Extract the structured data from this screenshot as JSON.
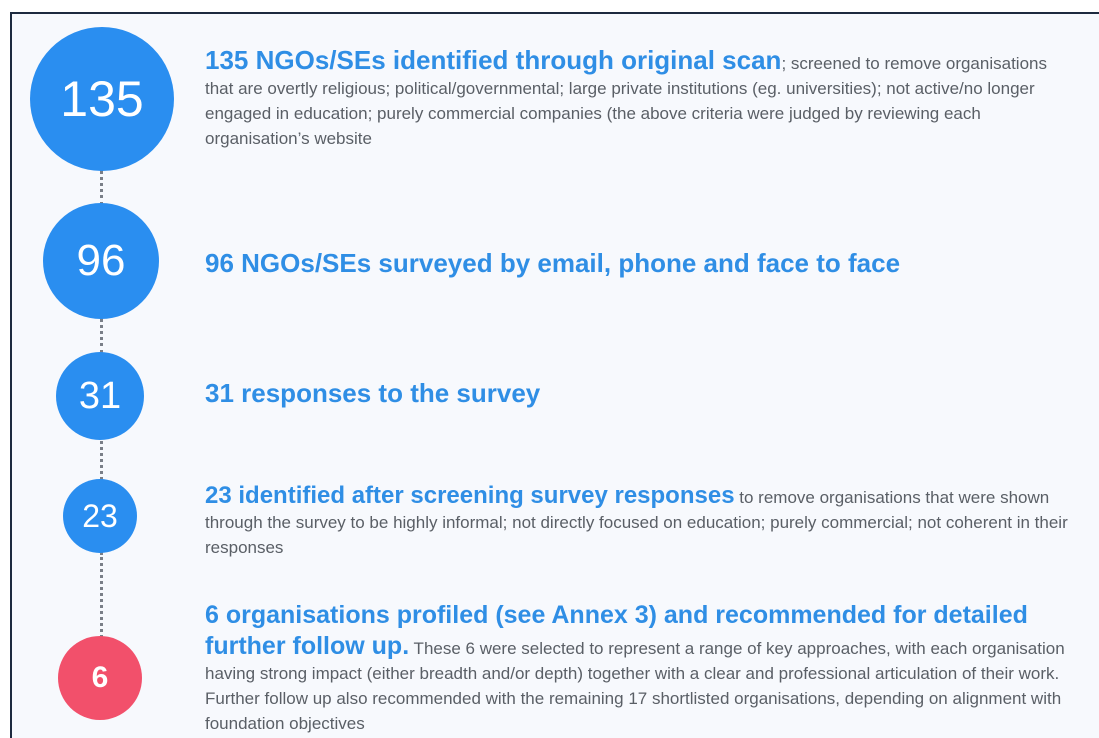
{
  "colors": {
    "step_circle": "#2a8ef0",
    "final_circle": "#f2506b",
    "headline": "#2f8ee5",
    "detail": "#5a5f66",
    "connector": "#7a7f88"
  },
  "steps": [
    {
      "number": "135",
      "headline": "135 NGOs/SEs identified through original scan",
      "detail": "; screened to remove organisations that are overtly religious; political/governmental; large private institutions (eg. universities); not active/no longer engaged in education; purely commercial companies (the above criteria were judged by reviewing each organisation’s website"
    },
    {
      "number": "96",
      "headline": "96 NGOs/SEs surveyed by email, phone and face to face",
      "detail": ""
    },
    {
      "number": "31",
      "headline": "31 responses to the survey",
      "detail": ""
    },
    {
      "number": "23",
      "headline": "23 identified after screening survey responses",
      "detail": " to remove organisations that were shown through the survey to be highly informal; not directly focused on education; purely commercial; not coherent in their responses"
    },
    {
      "number": "6",
      "headline": "6 organisations profiled (see Annex 3) and recommended for detailed further follow up.",
      "detail": " These 6 were selected to represent a range of key approaches, with each organisation having strong impact (either breadth and/or depth) together with a clear and professional articulation of their work.  Further follow up also recommended with the remaining 17 shortlisted organisations, depending on alignment with foundation objectives"
    }
  ]
}
